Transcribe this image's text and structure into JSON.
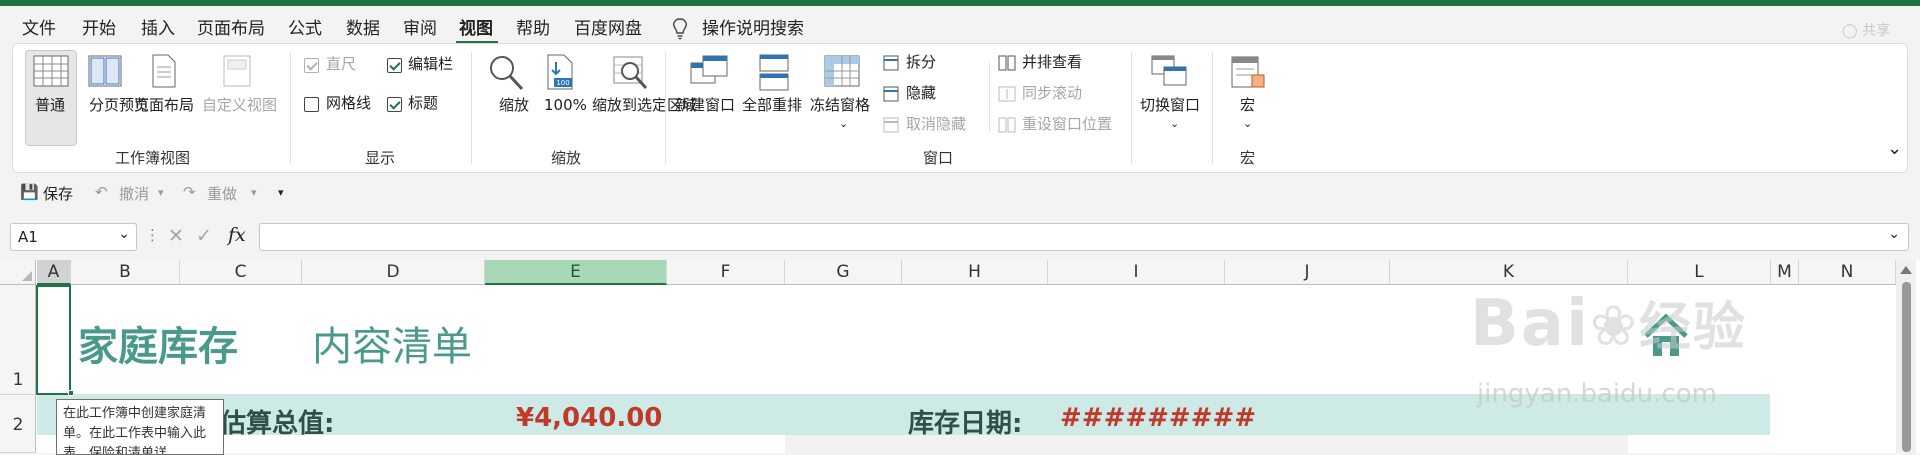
{
  "menu": {
    "tabs": [
      "文件",
      "开始",
      "插入",
      "页面布局",
      "公式",
      "数据",
      "审阅",
      "视图",
      "帮助",
      "百度网盘"
    ],
    "active_tab": "视图",
    "search": "操作说明搜索",
    "share": "共享"
  },
  "ribbon": {
    "workbook_views": {
      "label": "工作簿视图",
      "items": [
        "普通",
        "分页预览",
        "页面布局",
        "自定义视图"
      ]
    },
    "show": {
      "label": "显示",
      "ruler": "直尺",
      "formula_bar": "编辑栏",
      "gridlines": "网格线",
      "headings": "标题",
      "ruler_checked": true,
      "formula_bar_checked": true,
      "gridlines_checked": false,
      "headings_checked": true
    },
    "zoom": {
      "label": "缩放",
      "zoom": "缩放",
      "zoom_100": "100%",
      "zoom_selection": "缩放到选定区域"
    },
    "window": {
      "label": "窗口",
      "new_window": "新建窗口",
      "arrange_all": "全部重排",
      "freeze_panes": "冻结窗格",
      "split": "拆分",
      "hide": "隐藏",
      "unhide": "取消隐藏",
      "view_side_by_side": "并排查看",
      "sync_scroll": "同步滚动",
      "reset_position": "重设窗口位置",
      "switch_windows": "切换窗口"
    },
    "macros": {
      "label": "宏",
      "macros": "宏"
    }
  },
  "qat": {
    "save": "保存",
    "undo": "撤消",
    "redo": "重做"
  },
  "formula_bar": {
    "name_box": "A1",
    "fx": "fx",
    "content": ""
  },
  "sheet": {
    "columns": [
      "A",
      "B",
      "C",
      "D",
      "E",
      "F",
      "G",
      "H",
      "I",
      "J",
      "K",
      "L",
      "M",
      "N"
    ],
    "selected_column": "E",
    "rows": [
      "1",
      "2"
    ],
    "title_bold": "家庭库存",
    "title_light": "内容清单",
    "estimate_label": "估算总值:",
    "estimate_value": "¥4,040.00",
    "date_label": "库存日期:",
    "date_value": "#########",
    "tooltip": "在此工作簿中创建家庭清单。在此工作表中输入此表，保险和清单详"
  },
  "watermark": {
    "bai": "Bai",
    "du": "经验",
    "url": "jingyan.baidu.com"
  },
  "colors": {
    "accent": "#217346",
    "title": "#4a9a8c",
    "band": "#cdeae6",
    "value_red": "#c0392b"
  }
}
